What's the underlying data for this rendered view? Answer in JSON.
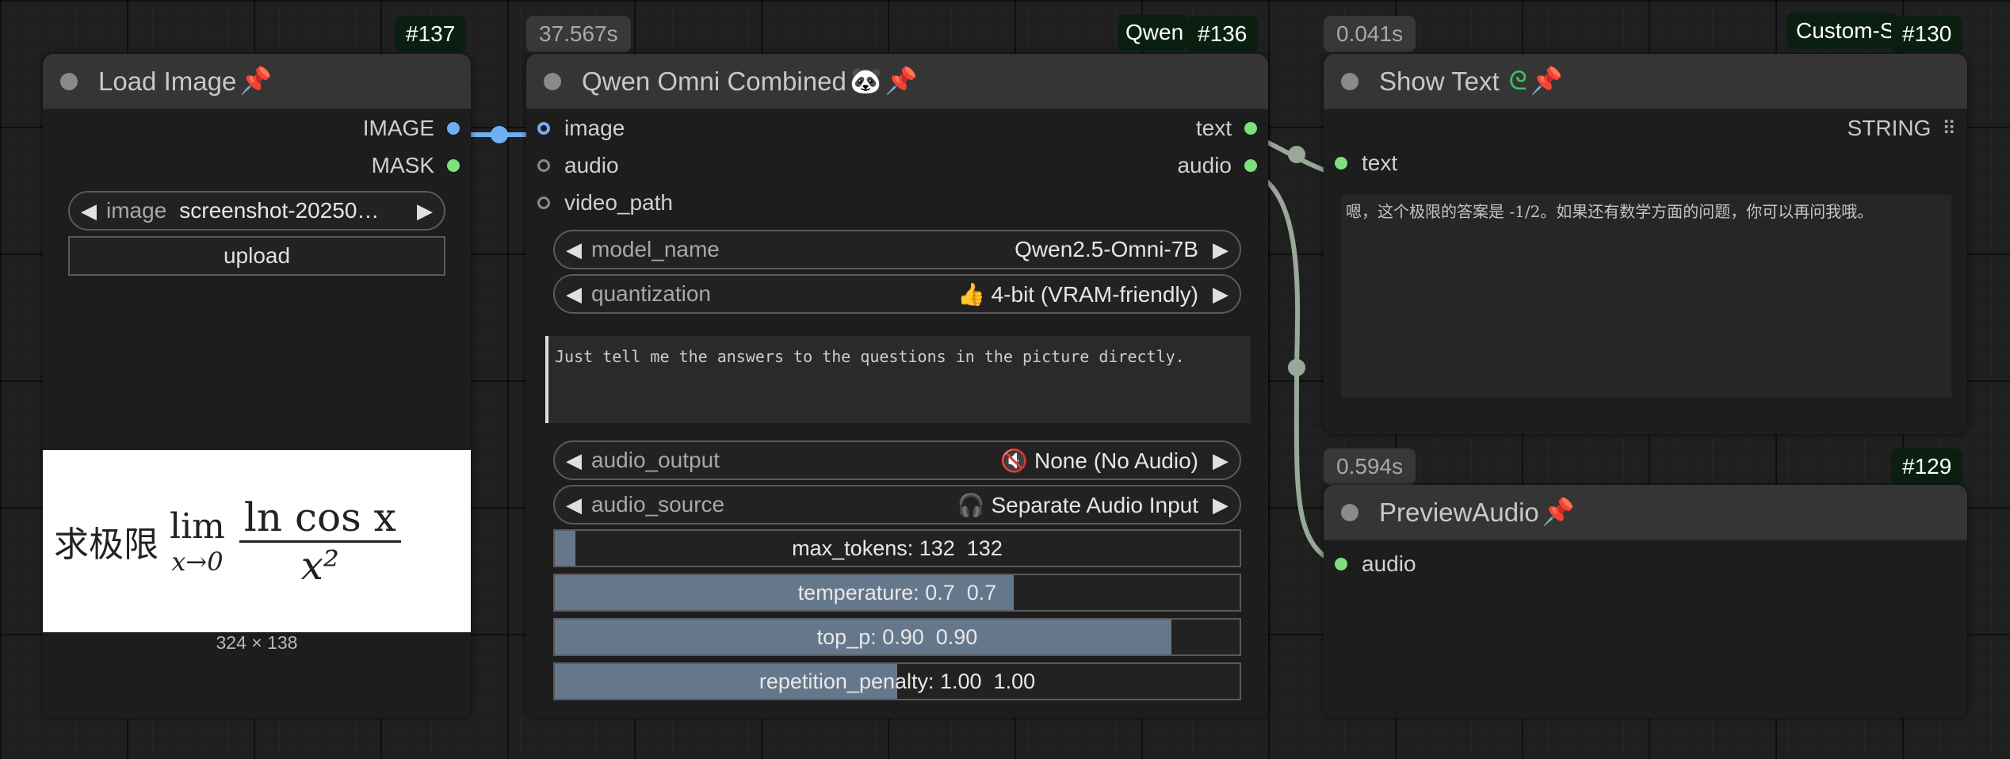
{
  "nodes": {
    "load_image": {
      "badge": "#137",
      "title": "Load Image",
      "outputs": {
        "image": "IMAGE",
        "mask": "MASK"
      },
      "image_widget": {
        "label": "image",
        "value": "screenshot-20250…"
      },
      "upload_label": "upload",
      "preview": {
        "prefix": "求极限",
        "lim": "lim",
        "sub": "x→0",
        "numerator": "ln cos x",
        "denominator": "x²"
      },
      "dimensions": "324 × 138"
    },
    "qwen": {
      "time": "37.567s",
      "badge_tag": "Qwen",
      "badge": "#136",
      "title": "Qwen Omni Combined",
      "inputs": {
        "image": "image",
        "audio": "audio",
        "video_path": "video_path"
      },
      "outputs": {
        "text": "text",
        "audio": "audio"
      },
      "model_name": {
        "label": "model_name",
        "value": "Qwen2.5-Omni-7B"
      },
      "quantization": {
        "label": "quantization",
        "value": "👍 4-bit (VRAM-friendly)"
      },
      "prompt": "Just tell me the answers to the questions in the picture directly.",
      "audio_output": {
        "label": "audio_output",
        "value": "🔇 None (No Audio)"
      },
      "audio_source": {
        "label": "audio_source",
        "value": "🎧 Separate Audio Input"
      },
      "sliders": [
        {
          "text": "max_tokens: 132  132",
          "fill_fraction": 0.03
        },
        {
          "text": "temperature: 0.7  0.7",
          "fill_fraction": 0.67
        },
        {
          "text": "top_p: 0.90  0.90",
          "fill_fraction": 0.9
        },
        {
          "text": "repetition_penalty: 1.00  1.00",
          "fill_fraction": 0.5
        }
      ]
    },
    "show_text": {
      "time": "0.041s",
      "badge_tag": "Custom-S",
      "badge": "#130",
      "title": "Show Text",
      "output": "STRING",
      "input": "text",
      "content": "嗯，这个极限的答案是 -1/2。如果还有数学方面的问题，你可以再问我哦。"
    },
    "preview_audio": {
      "time": "0.594s",
      "badge": "#129",
      "title": "PreviewAudio",
      "input": "audio"
    }
  },
  "icons": {
    "pin": "pin-icon",
    "panda": "panda-icon",
    "snake": "snake-icon",
    "grid": "grid-icon"
  },
  "colors": {
    "image_link": "#6fb0f0",
    "string_link": "#9aa89a",
    "green_slot": "#7ee07e"
  }
}
